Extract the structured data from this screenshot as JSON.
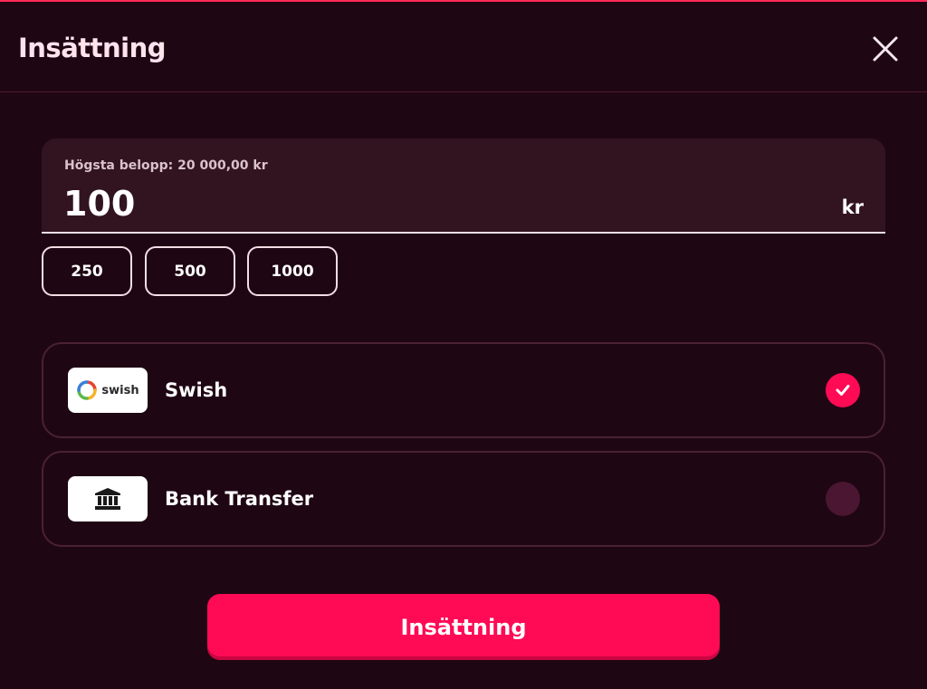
{
  "header": {
    "title": "Insättning",
    "close_icon": "close-icon"
  },
  "amount": {
    "label": "Högsta belopp: 20 000,00 kr",
    "value": "100",
    "currency": "kr"
  },
  "quick_amounts": [
    "250",
    "500",
    "1000"
  ],
  "payment_methods": [
    {
      "name": "Swish",
      "logo_text": "swish",
      "icon": "swish-logo-icon",
      "selected": true
    },
    {
      "name": "Bank Transfer",
      "icon": "bank-icon",
      "selected": false
    }
  ],
  "submit": {
    "label": "Insättning"
  },
  "colors": {
    "background": "#1f0613",
    "accent": "#ff0a55",
    "input_background": "#321420",
    "card_border": "#4a2132"
  }
}
